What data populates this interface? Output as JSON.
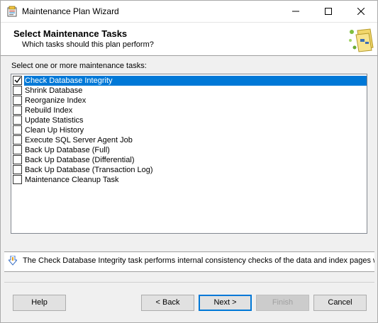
{
  "window": {
    "title": "Maintenance Plan Wizard"
  },
  "header": {
    "title": "Select Maintenance Tasks",
    "subtitle": "Which tasks should this plan perform?"
  },
  "prompt": "Select one or more maintenance tasks:",
  "tasks": [
    {
      "label": "Check Database Integrity",
      "checked": true,
      "selected": true
    },
    {
      "label": "Shrink Database",
      "checked": false,
      "selected": false
    },
    {
      "label": "Reorganize Index",
      "checked": false,
      "selected": false
    },
    {
      "label": "Rebuild Index",
      "checked": false,
      "selected": false
    },
    {
      "label": "Update Statistics",
      "checked": false,
      "selected": false
    },
    {
      "label": "Clean Up History",
      "checked": false,
      "selected": false
    },
    {
      "label": "Execute SQL Server Agent Job",
      "checked": false,
      "selected": false
    },
    {
      "label": "Back Up Database (Full)",
      "checked": false,
      "selected": false
    },
    {
      "label": "Back Up Database (Differential)",
      "checked": false,
      "selected": false
    },
    {
      "label": "Back Up Database (Transaction Log)",
      "checked": false,
      "selected": false
    },
    {
      "label": "Maintenance Cleanup Task",
      "checked": false,
      "selected": false
    }
  ],
  "description": "The Check Database Integrity task performs internal consistency checks of the data and index pages with",
  "buttons": {
    "help": "Help",
    "back": "< Back",
    "next": "Next >",
    "finish": "Finish",
    "cancel": "Cancel"
  },
  "colors": {
    "selection": "#0078d7",
    "background": "#f0f0f0"
  }
}
